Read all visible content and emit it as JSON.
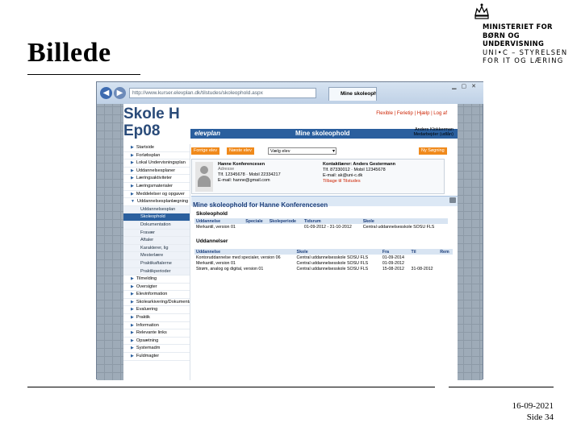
{
  "slide": {
    "title": "Billede",
    "date": "16-09-2021",
    "slide_number": "Side 34",
    "ministry": [
      "MINISTERIET FOR",
      "BØRN OG",
      "UNDERVISNING"
    ],
    "agency": [
      "UNI•C – STYRELSEN",
      "FOR IT OG LÆRING"
    ]
  },
  "browser": {
    "url": "http://www.kurser.elevplan.dk/tilstudes/skoleophold.aspx",
    "tab_title": "Mine skoleophold"
  },
  "app": {
    "logo_line1": "Skole H",
    "logo_line2": "Ep08",
    "brand": "elevplan",
    "page_heading": "Mine skoleophold",
    "user_name": "Anders Klokkerman",
    "user_role": "Medarbejder (udlån)",
    "top_links": "Flexible | Ferietip | Hjælp | Log af",
    "nav": [
      {
        "label": "Startside",
        "type": "top"
      },
      {
        "label": "Forløbsplan",
        "type": "top"
      },
      {
        "label": "Lokal Undervisningsplan",
        "type": "top"
      },
      {
        "label": "Uddannelsesplaner",
        "type": "top"
      },
      {
        "label": "Læringsaktiviteter",
        "type": "top"
      },
      {
        "label": "Læringsmaterialer",
        "type": "top"
      },
      {
        "label": "Meddelelser og opgaver",
        "type": "top"
      },
      {
        "label": "Uddannelsesplanlægning",
        "type": "top"
      },
      {
        "label": "Uddannelsesplan",
        "type": "sub"
      },
      {
        "label": "Skoleophold",
        "type": "sel"
      },
      {
        "label": "Dokumentation",
        "type": "sub"
      },
      {
        "label": "Fravær",
        "type": "sub"
      },
      {
        "label": "Aftaler",
        "type": "sub"
      },
      {
        "label": "Karakterer, lig",
        "type": "sub"
      },
      {
        "label": "Mesterlære",
        "type": "sub"
      },
      {
        "label": "Praktikaftalerne",
        "type": "sub"
      },
      {
        "label": "Praktikperioder",
        "type": "sub"
      },
      {
        "label": "Tilmelding",
        "type": "top"
      },
      {
        "label": "Oversigter",
        "type": "top"
      },
      {
        "label": "Elevinformation",
        "type": "top"
      },
      {
        "label": "Skolearkivering/Dokumentation",
        "type": "top"
      },
      {
        "label": "Evaluering",
        "type": "top"
      },
      {
        "label": "Praktik",
        "type": "top"
      },
      {
        "label": "Information",
        "type": "top"
      },
      {
        "label": "Relevante links",
        "type": "top"
      },
      {
        "label": "Opsætning",
        "type": "top"
      },
      {
        "label": "Systemadm",
        "type": "top"
      },
      {
        "label": "Fuldmagter",
        "type": "top"
      }
    ],
    "toolbar": {
      "prev_button": "Forrige elev",
      "next_button": "Næste elev",
      "select_value": "Vælg elev",
      "right_button": "Ny Søgning"
    },
    "card": {
      "name": "Hanne Konferencesen",
      "address": "Adresse",
      "phone": "Tlf. 12345678 · Mobil 22334217",
      "email": "E-mail: hanne@gmail.com",
      "contact_label": "Kontaktlærer: Anders Gestermann",
      "contact_phone": "Tlf. 87330012 · Mobil 12345678",
      "contact_email": "E-mail: ak@uni-c.dk",
      "contact_link": "Tilbage til Tilstudes"
    },
    "section_bar": "Mine skoleophold for Hanne Konferencesen",
    "skoleophold": {
      "heading": "Skoleophold",
      "headers": [
        "Uddannelse",
        "Speciale",
        "Skoleperiode",
        "Tidsrum",
        "Skole"
      ],
      "rows": [
        [
          "Merkantil, version 01",
          "",
          "",
          "01-09-2012 - 31-10-2012",
          "Central uddannelsesskole SOSU FLS"
        ]
      ]
    },
    "uddannelser": {
      "heading": "Uddannelser",
      "headers": [
        "Uddannelse",
        "Skole",
        "Fra",
        "Til",
        "Rem"
      ],
      "rows": [
        [
          "Kontoruddannelse med specialer, version 06",
          "Central uddannelsesskole SOSU FLS",
          "01-09-2014",
          "",
          ""
        ],
        [
          "Merkantil, version 01",
          "Central uddannelsesskole SOSU FLS",
          "01-09-2012",
          "",
          ""
        ],
        [
          "Strøm, analog og digital, version 01",
          "Central uddannelsesskole SOSU FLS",
          "15-08-2012",
          "31-08-2012",
          ""
        ]
      ]
    }
  }
}
